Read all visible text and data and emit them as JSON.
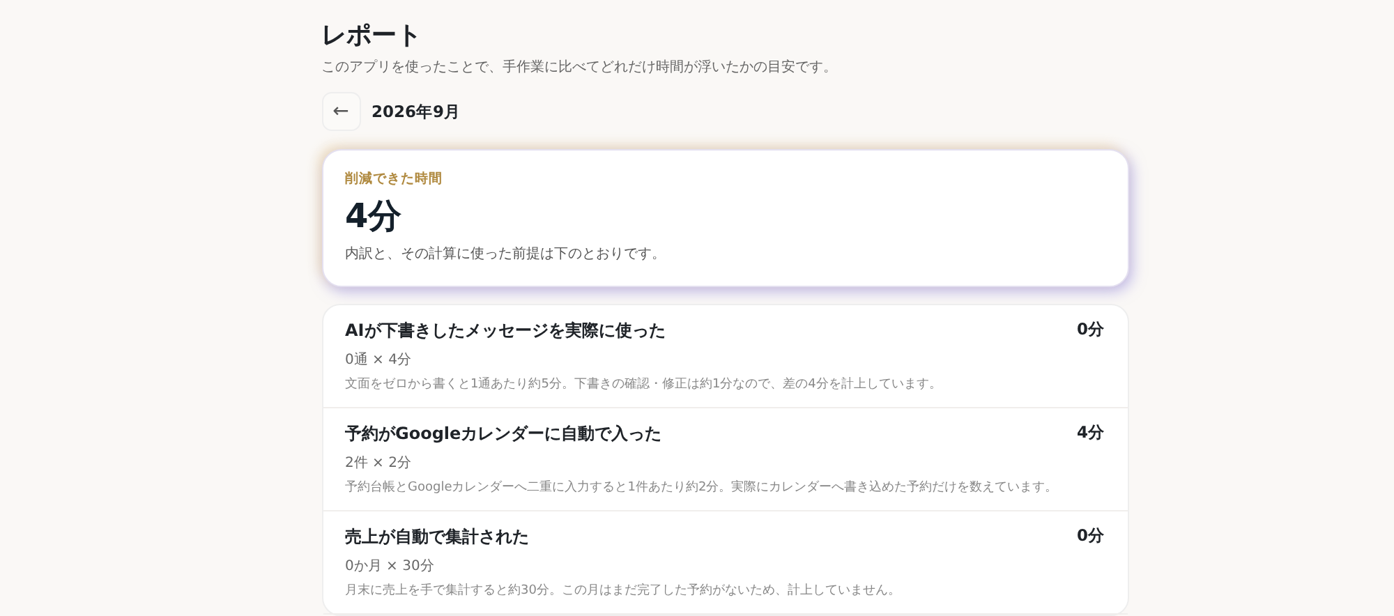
{
  "header": {
    "title": "レポート",
    "subtitle": "このアプリを使ったことで、手作業に比べてどれだけ時間が浮いたかの目安です。"
  },
  "month_nav": {
    "back_icon": "←",
    "month": "2026年9月"
  },
  "summary": {
    "label": "削減できた時間",
    "value": "4分",
    "note": "内訳と、その計算に使った前提は下のとおりです。"
  },
  "items": [
    {
      "title": "AIが下書きしたメッセージを実際に使った",
      "value": "0分",
      "formula": "0通 × 4分",
      "explanation": "文面をゼロから書くと1通あたり約5分。下書きの確認・修正は約1分なので、差の4分を計上しています。"
    },
    {
      "title": "予約がGoogleカレンダーに自動で入った",
      "value": "4分",
      "formula": "2件 × 2分",
      "explanation": "予約台帳とGoogleカレンダーへ二重に入力すると1件あたり約2分。実際にカレンダーへ書き込めた予約だけを数えています。"
    },
    {
      "title": "売上が自動で集計された",
      "value": "0分",
      "formula": "0か月 × 30分",
      "explanation": "月末に売上を手で集計すると約30分。この月はまだ完了した予約がないため、計上していません。"
    }
  ]
}
